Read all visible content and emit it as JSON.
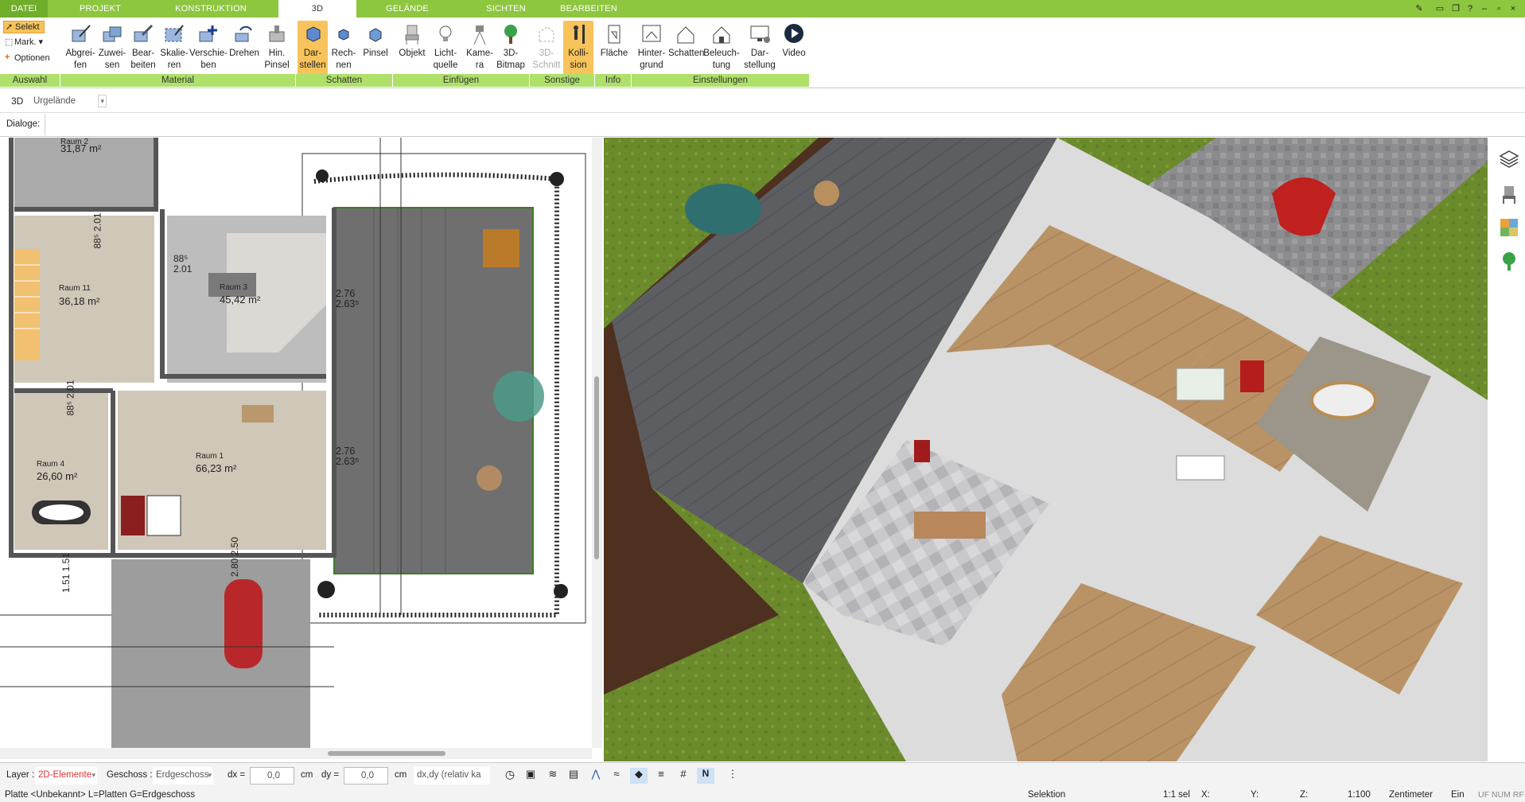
{
  "menu": {
    "tabs": [
      "DATEI",
      "PROJEKT",
      "KONSTRUKTION",
      "3D",
      "GELÄNDE",
      "SICHTEN",
      "BEARBEITEN"
    ],
    "active_tab": "3D"
  },
  "ribbon": {
    "selection": {
      "selekt": "Selekt",
      "mark": "Mark.",
      "optionen": "Optionen"
    },
    "buttons": [
      {
        "line1": "Abgrei-",
        "line2": "fen"
      },
      {
        "line1": "Zuwei-",
        "line2": "sen"
      },
      {
        "line1": "Bear-",
        "line2": "beiten"
      },
      {
        "line1": "Skalie-",
        "line2": "ren"
      },
      {
        "line1": "Verschie-",
        "line2": "ben"
      },
      {
        "line1": "Drehen",
        "line2": ""
      },
      {
        "line1": "Hin.",
        "line2": "Pinsel"
      },
      {
        "line1": "Dar-",
        "line2": "stellen"
      },
      {
        "line1": "Rech-",
        "line2": "nen"
      },
      {
        "line1": "Pinsel",
        "line2": ""
      },
      {
        "line1": "Objekt",
        "line2": ""
      },
      {
        "line1": "Licht-",
        "line2": "quelle"
      },
      {
        "line1": "Kame-",
        "line2": "ra"
      },
      {
        "line1": "3D-",
        "line2": "Bitmap"
      },
      {
        "line1": "3D-",
        "line2": "Schnitt"
      },
      {
        "line1": "Kolli-",
        "line2": "sion"
      },
      {
        "line1": "Fläche",
        "line2": ""
      },
      {
        "line1": "Hinter-",
        "line2": "grund"
      },
      {
        "line1": "Schatten",
        "line2": ""
      },
      {
        "line1": "Beleuch-",
        "line2": "tung"
      },
      {
        "line1": "Dar-",
        "line2": "stellung"
      },
      {
        "line1": "Video",
        "line2": ""
      }
    ],
    "groups": [
      "Auswahl",
      "Material",
      "Schatten",
      "Einfügen",
      "Sonstige",
      "Info",
      "Einstellungen"
    ]
  },
  "viewbar": {
    "mode": "3D",
    "terrain": "Urgelände"
  },
  "dialoge_label": "Dialoge:",
  "plan": {
    "rooms": [
      {
        "name": "Raum 2",
        "area": "31,87 m²"
      },
      {
        "name": "Raum 11",
        "area": "36,18 m²"
      },
      {
        "name": "Raum 3",
        "area": "45,42 m²"
      },
      {
        "name": "Raum 4",
        "area": "26,60 m²"
      },
      {
        "name": "Raum 1",
        "area": "66,23 m²"
      }
    ],
    "dims": [
      {
        "a": "88⁵",
        "b": "2.01"
      },
      {
        "a": "88⁵",
        "b": "2.01"
      },
      {
        "a": "2.76",
        "b": "2.63⁵"
      },
      {
        "a": "88⁵",
        "b": "2.01"
      },
      {
        "a": "2.76",
        "b": "2.63⁵"
      },
      {
        "a": "2.80",
        "b": "2.50"
      },
      {
        "a": "1.51",
        "b": "1.51"
      }
    ]
  },
  "bottom": {
    "layer_label": "Layer :",
    "layer_value": "2D-Elemente",
    "geschoss_label": "Geschoss :",
    "geschoss_value": "Erdgeschoss",
    "dx_label": "dx =",
    "dx_value": "0,0",
    "dy_label": "dy =",
    "dy_value": "0,0",
    "unit": "cm",
    "mode_value": "dx,dy (relativ ka"
  },
  "status": {
    "left": "Platte <Unbekannt> L=Platten G=Erdgeschoss",
    "selektion": "Selektion",
    "sel": "1:1 sel",
    "x": "X:",
    "y": "Y:",
    "z": "Z:",
    "scale": "1:100",
    "unit": "Zentimeter",
    "ein": "Ein",
    "flags": "UF NUM RF"
  },
  "colors": {
    "accent": "#8dc63f",
    "group_bar": "#aee06a",
    "highlight": "#f7c35a"
  }
}
